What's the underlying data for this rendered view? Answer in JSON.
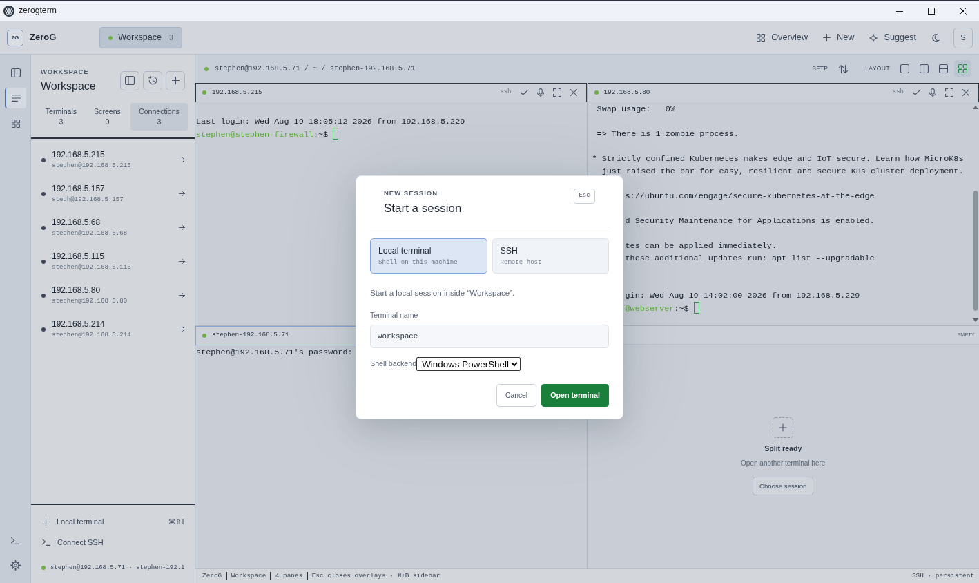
{
  "window": {
    "title": "zerogterm"
  },
  "header": {
    "logo": "ZG",
    "brand": "ZeroG",
    "workspace_tab": {
      "label": "Workspace",
      "count": "3",
      "selected": true
    },
    "actions": [
      {
        "kind": "overview",
        "label": "Overview"
      },
      {
        "kind": "new",
        "label": "New"
      },
      {
        "kind": "suggest",
        "label": "Suggest"
      }
    ],
    "avatar": "S"
  },
  "rail": {
    "items": [
      {
        "selected": false
      },
      {
        "selected": true
      },
      {
        "selected": false
      }
    ]
  },
  "sidebar": {
    "eyebrow": "WORKSPACE",
    "title": "Workspace",
    "stats": [
      {
        "label": "Terminals",
        "value": "3",
        "selected": false
      },
      {
        "label": "Screens",
        "value": "0",
        "selected": false
      },
      {
        "label": "Connections",
        "value": "3",
        "selected": true
      }
    ],
    "connections": [
      {
        "name": "192.168.5.215",
        "user": "stephen@192.168.5.215"
      },
      {
        "name": "192.168.5.157",
        "user": "steph@192.168.5.157"
      },
      {
        "name": "192.168.5.68",
        "user": "stephen@192.168.5.68"
      },
      {
        "name": "192.168.5.115",
        "user": "stephen@192.168.5.115"
      },
      {
        "name": "192.168.5.80",
        "user": "stephen@192.168.5.80"
      },
      {
        "name": "192.168.5.214",
        "user": "stephen@192.168.5.214"
      }
    ],
    "actions": [
      {
        "kind": "local",
        "label": "Local terminal",
        "shortcut": "⌘⇧T"
      },
      {
        "kind": "ssh",
        "label": "Connect SSH"
      }
    ],
    "status": "stephen@192.168.5.71 · stephen-192.1"
  },
  "toolbar": {
    "breadcrumb": "stephen@192.168.5.71 / ~ / stephen-192.168.5.71",
    "sftp": "SFTP",
    "layout_label": "LAYOUT",
    "layouts": [
      {
        "selected": false
      },
      {
        "selected": false
      },
      {
        "selected": false
      },
      {
        "selected": true
      }
    ]
  },
  "panes": [
    {
      "kind": "terminal",
      "title": "192.168.5.215",
      "protocol": "ssh",
      "selected": false,
      "scrollable": false,
      "lines": [
        {
          "kind": "blank"
        },
        {
          "kind": "text",
          "text": "Last login: Wed Aug 19 18:05:12 2026 from 192.168.5.229"
        },
        {
          "kind": "prompt",
          "user": "stephen@stephen-firewall",
          "path": ":~$"
        }
      ]
    },
    {
      "kind": "terminal",
      "title": "192.168.5.80",
      "protocol": "ssh",
      "selected": false,
      "scrollable": true,
      "lines": [
        {
          "kind": "text",
          "text": " Swap usage:   0%"
        },
        {
          "kind": "blank"
        },
        {
          "kind": "text",
          "text": " => There is 1 zombie process."
        },
        {
          "kind": "blank"
        },
        {
          "kind": "text",
          "text": "* Strictly confined Kubernetes makes edge and IoT secure. Learn how MicroK8s"
        },
        {
          "kind": "text",
          "text": "  just raised the bar for easy, resilient and secure K8s cluster deployment."
        },
        {
          "kind": "blank"
        },
        {
          "kind": "tail",
          "text": "s://ubuntu.com/engage/secure-kubernetes-at-the-edge"
        },
        {
          "kind": "blank"
        },
        {
          "kind": "tail",
          "text": "d Security Maintenance for Applications is enabled."
        },
        {
          "kind": "blank"
        },
        {
          "kind": "tail",
          "text": "tes can be applied immediately."
        },
        {
          "kind": "tail",
          "text": "these additional updates run: apt list --upgradable"
        },
        {
          "kind": "blank"
        },
        {
          "kind": "blank"
        },
        {
          "kind": "tail",
          "text": "gin: Wed Aug 19 14:02:00 2026 from 192.168.5.229"
        },
        {
          "kind": "prompt_tail",
          "user": "@webserver",
          "path": ":~$"
        }
      ]
    },
    {
      "kind": "terminal",
      "title": "stephen-192.168.5.71",
      "selected": true,
      "scrollable": false,
      "lines": [
        {
          "kind": "text",
          "text": "stephen@192.168.5.71's password:"
        }
      ]
    },
    {
      "kind": "empty",
      "badge": "EMPTY",
      "title": "Split ready",
      "subtitle": "Open another terminal here",
      "button": "Choose session"
    }
  ],
  "status_bar": {
    "items": [
      "ZeroG",
      "Workspace",
      "4 panes",
      "Esc closes overlays · ⌘⇧B sidebar"
    ],
    "right": "SSH · persistent"
  },
  "dialog": {
    "eyebrow": "NEW SESSION",
    "title": "Start a session",
    "close_hint": "Esc",
    "options": [
      {
        "title": "Local terminal",
        "subtitle": "Shell on this machine",
        "selected": true
      },
      {
        "title": "SSH",
        "subtitle": "Remote host",
        "selected": false
      }
    ],
    "description": "Start a local session inside “Workspace”.",
    "name_label": "Terminal name",
    "name_value": "workspace",
    "backend_label": "Shell backend",
    "backend_value": "Windows PowerShell",
    "buttons": [
      {
        "kind": "secondary",
        "label": "Cancel"
      },
      {
        "kind": "primary",
        "label": "Open terminal"
      }
    ]
  }
}
